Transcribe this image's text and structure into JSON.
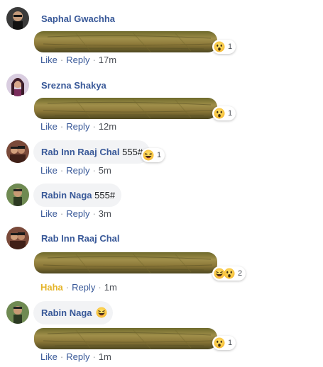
{
  "comments": [
    {
      "author": "Saphal Gwachha",
      "type": "sticker",
      "reactions": [
        "wow"
      ],
      "reaction_count": "1",
      "actions": {
        "like": "Like",
        "reply": "Reply",
        "time": "17m"
      }
    },
    {
      "author": "Srezna Shakya",
      "type": "sticker",
      "reactions": [
        "wow"
      ],
      "reaction_count": "1",
      "actions": {
        "like": "Like",
        "reply": "Reply",
        "time": "12m"
      }
    },
    {
      "author": "Rab Inn Raaj Chal",
      "type": "text",
      "text": "555#",
      "reactions": [
        "haha"
      ],
      "reaction_count": "1",
      "actions": {
        "like": "Like",
        "reply": "Reply",
        "time": "5m"
      }
    },
    {
      "author": "Rabin Naga",
      "type": "text",
      "text": "555#",
      "actions": {
        "like": "Like",
        "reply": "Reply",
        "time": "3m"
      }
    },
    {
      "author": "Rab Inn Raaj Chal",
      "type": "sticker",
      "reactions": [
        "haha",
        "wow"
      ],
      "reaction_count": "2",
      "actions": {
        "like": "Haha",
        "reply": "Reply",
        "time": "1m"
      }
    },
    {
      "author": "Rabin Naga",
      "type": "text",
      "text": "",
      "emoji": "laughing-emoji",
      "reactions": [
        "wow"
      ],
      "reaction_count": "1",
      "actions": {
        "like": "Like",
        "reply": "Reply",
        "time": "1m"
      }
    }
  ],
  "colors": {
    "author": "#385898",
    "bubble": "#f2f3f5",
    "haha_active": "#e4b429",
    "cigar": "#8a7a3a"
  }
}
